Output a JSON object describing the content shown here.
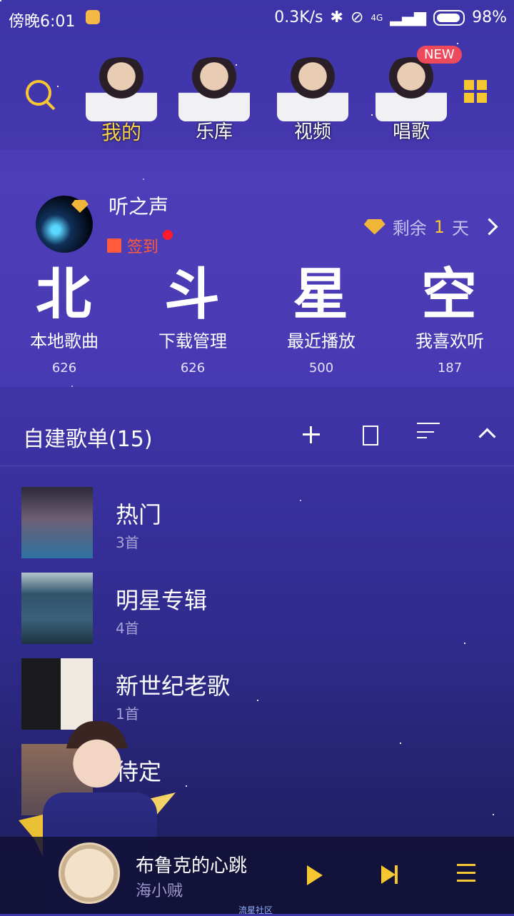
{
  "status": {
    "time": "傍晚6:01",
    "speed": "0.3K/s",
    "network": "4G",
    "battery": "98%"
  },
  "nav": {
    "tabs": [
      {
        "label": "我的",
        "active": true
      },
      {
        "label": "乐库",
        "active": false
      },
      {
        "label": "视频",
        "active": false
      },
      {
        "label": "唱歌",
        "active": false
      }
    ],
    "new_badge": "NEW"
  },
  "profile": {
    "name": "听之声",
    "signin_label": "签到",
    "vip": {
      "prefix": "剩余",
      "days": "1",
      "suffix": "天"
    }
  },
  "quick": [
    {
      "big": "北",
      "label": "本地歌曲",
      "count": "626"
    },
    {
      "big": "斗",
      "label": "下载管理",
      "count": "626"
    },
    {
      "big": "星",
      "label": "最近播放",
      "count": "500"
    },
    {
      "big": "空",
      "label": "我喜欢听",
      "count": "187"
    }
  ],
  "playlists": {
    "header": "自建歌单(15)",
    "items": [
      {
        "name": "热门",
        "count": "3首"
      },
      {
        "name": "明星专辑",
        "count": "4首"
      },
      {
        "name": "新世纪老歌",
        "count": "1首"
      },
      {
        "name": "待定",
        "count": ""
      }
    ]
  },
  "player": {
    "title": "布鲁克的心跳",
    "artist": "海小贼",
    "community": "流星社区"
  },
  "colors": {
    "accent": "#f7c731",
    "signin": "#ff5b3a",
    "badge": "#ef4a5b"
  }
}
